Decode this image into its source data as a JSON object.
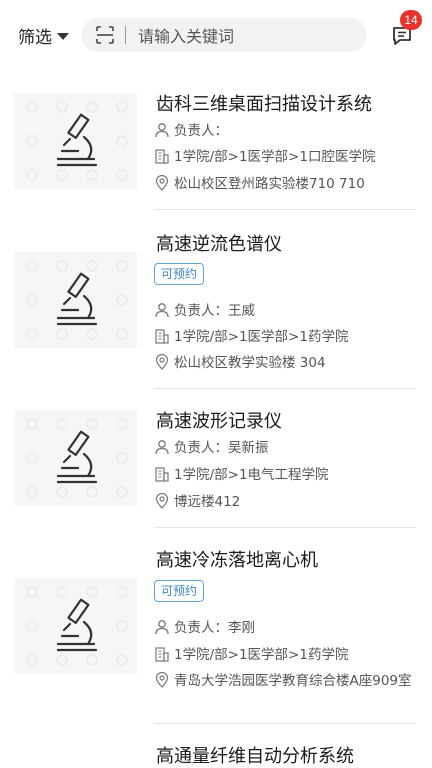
{
  "header": {
    "filter_label": "筛选",
    "search_placeholder": "请输入关键词",
    "message_badge": "14"
  },
  "items": [
    {
      "title": "齿科三维桌面扫描设计系统",
      "tag": "",
      "owner": "负责人：",
      "dept": "1学院/部>1医学部>1口腔医学院",
      "location": "松山校区登州路实验楼710 710"
    },
    {
      "title": "高速逆流色谱仪",
      "tag": "可预约",
      "owner": "负责人：王威",
      "dept": "1学院/部>1医学部>1药学院",
      "location": "松山校区教学实验楼 304"
    },
    {
      "title": "高速波形记录仪",
      "tag": "",
      "owner": "负责人：吴新振",
      "dept": "1学院/部>1电气工程学院",
      "location": "博远楼412"
    },
    {
      "title": "高速冷冻落地离心机",
      "tag": "可预约",
      "owner": "负责人：李刚",
      "dept": "1学院/部>1医学部>1药学院",
      "location": "青岛大学浩园医学教育综合楼A座909室"
    },
    {
      "title": "高通量纤维自动分析系统"
    }
  ],
  "icons": {
    "filter_caret": "caret-down-icon",
    "scan": "scan-icon",
    "message": "message-icon",
    "owner": "user-icon",
    "dept": "building-icon",
    "location": "location-pin-icon",
    "thumb": "microscope-icon"
  },
  "colors": {
    "badge": "#e8332d",
    "tag_border": "#5fa3d6",
    "tag_text": "#3a86c8"
  }
}
